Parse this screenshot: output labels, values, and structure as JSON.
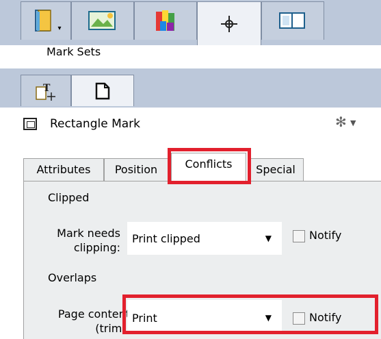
{
  "top_tabs": [
    {
      "icon": "book-icon",
      "has_dropdown": true
    },
    {
      "icon": "image-frame-icon"
    },
    {
      "icon": "color-swatches-icon"
    },
    {
      "icon": "crosshair-icon",
      "active": true
    },
    {
      "icon": "layout-icon"
    }
  ],
  "sets_label": "Mark Sets",
  "mini_buttons": [
    {
      "icon": "text-mark-icon"
    },
    {
      "icon": "page-icon"
    }
  ],
  "mark": {
    "icon": "rectangle-mark-icon",
    "title": "Rectangle Mark",
    "menu_icon": "gear-icon"
  },
  "tabs": [
    "Attributes",
    "Position",
    "Conflicts",
    "Special"
  ],
  "active_tab": "Conflicts",
  "sections": {
    "clipped": "Clipped",
    "overlaps": "Overlaps"
  },
  "fields": {
    "mark_needs_clipping": {
      "label_line1": "Mark needs",
      "label_line2": "clipping:",
      "value": "Print clipped",
      "notify_label": "Notify",
      "notify_checked": false
    },
    "page_content": {
      "label_line1": "Page content",
      "label_line2": "(trim):",
      "value": "Print",
      "notify_label": "Notify",
      "notify_checked": false
    }
  },
  "colors": {
    "highlight": "#e2202d",
    "chrome": "#bcc8da"
  }
}
